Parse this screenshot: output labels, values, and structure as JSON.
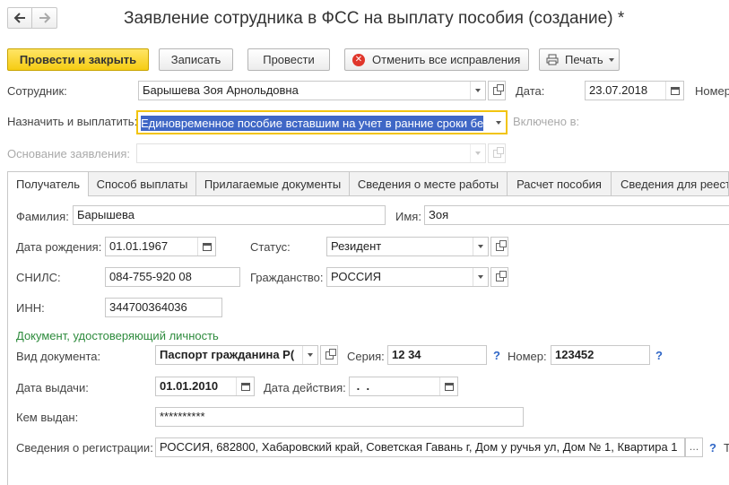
{
  "window": {
    "title": "Заявление сотрудника в ФСС на выплату пособия (создание) *"
  },
  "toolbar": {
    "post_close": "Провести и закрыть",
    "save": "Записать",
    "post": "Провести",
    "cancel_all": "Отменить все исправления",
    "print": "Печать"
  },
  "header": {
    "employee_label": "Сотрудник:",
    "employee_value": "Барышева Зоя Арнольдовна",
    "date_label": "Дата:",
    "date_value": "23.07.2018",
    "number_label": "Номер",
    "assign_label": "Назначить и выплатить:",
    "assign_value": "Единовременное пособие вставшим на учет в ранние сроки бе",
    "included_label": "Включено в:",
    "basis_label": "Основание заявления:"
  },
  "tabs": [
    {
      "label": "Получатель",
      "active": true
    },
    {
      "label": "Способ выплаты"
    },
    {
      "label": "Прилагаемые документы"
    },
    {
      "label": "Сведения о месте работы"
    },
    {
      "label": "Расчет пособия"
    },
    {
      "label": "Сведения для реест"
    }
  ],
  "recipient": {
    "surname_label": "Фамилия:",
    "surname": "Барышева",
    "name_label": "Имя:",
    "name": "Зоя",
    "birth_label": "Дата рождения:",
    "birth": "01.01.1967",
    "status_label": "Статус:",
    "status": "Резидент",
    "snils_label": "СНИЛС:",
    "snils": "084-755-920 08",
    "citizenship_label": "Гражданство:",
    "citizenship": "РОССИЯ",
    "inn_label": "ИНН:",
    "inn": "344700364036"
  },
  "document": {
    "section_title": "Документ, удостоверяющий личность",
    "type_label": "Вид документа:",
    "type": "Паспорт гражданина Р(",
    "series_label": "Серия:",
    "series": "12 34",
    "number_label": "Номер:",
    "number": "123452",
    "help": "?",
    "issue_label": "Дата выдачи:",
    "issue": "01.01.2010",
    "valid_label": "Дата действия:",
    "valid": " .  .",
    "issued_by_label": "Кем выдан:",
    "issued_by": "**********",
    "registration_label": "Сведения о регистрации:",
    "registration": "РОССИЯ, 682800, Хабаровский край, Советская Гавань г, Дом у ручья ул, Дом № 1, Квартира 1",
    "tel_cut": "Т"
  },
  "colors": {
    "accent": "#f6cc13",
    "focus": "#f2c40f",
    "section": "#2e8b3d",
    "help": "#2f66c6"
  }
}
